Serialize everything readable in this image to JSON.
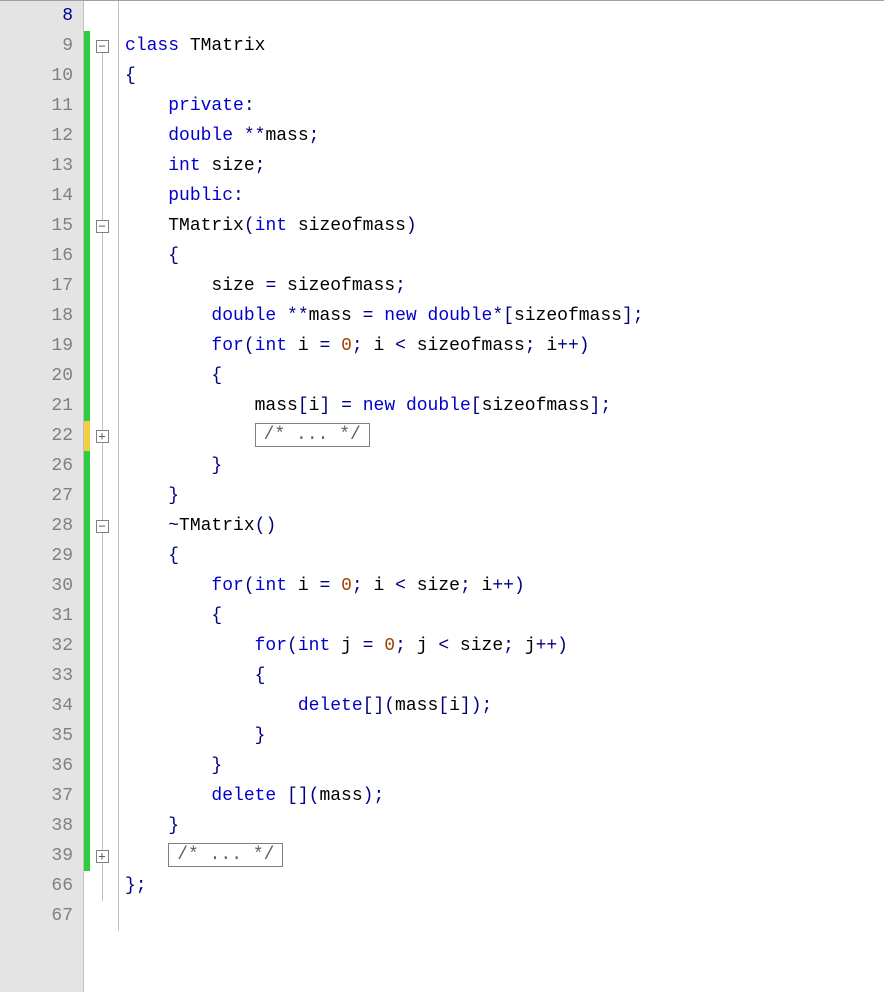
{
  "lineNumbers": [
    "8",
    "9",
    "10",
    "11",
    "12",
    "13",
    "14",
    "15",
    "16",
    "17",
    "18",
    "19",
    "20",
    "21",
    "22",
    "26",
    "27",
    "28",
    "29",
    "30",
    "31",
    "32",
    "33",
    "34",
    "35",
    "36",
    "37",
    "38",
    "39",
    "66",
    "67"
  ],
  "currentLine": "8",
  "changeBars": [
    "none",
    "green",
    "green",
    "green",
    "green",
    "green",
    "green",
    "green",
    "green",
    "green",
    "green",
    "green",
    "green",
    "green",
    "yellow",
    "green",
    "green",
    "green",
    "green",
    "green",
    "green",
    "green",
    "green",
    "green",
    "green",
    "green",
    "green",
    "green",
    "green",
    "none",
    "none"
  ],
  "foldCells": [
    {
      "type": "none"
    },
    {
      "type": "minus",
      "line": "start"
    },
    {
      "type": "line"
    },
    {
      "type": "line"
    },
    {
      "type": "line"
    },
    {
      "type": "line"
    },
    {
      "type": "line"
    },
    {
      "type": "minus",
      "line": "mid"
    },
    {
      "type": "line"
    },
    {
      "type": "line"
    },
    {
      "type": "line"
    },
    {
      "type": "line"
    },
    {
      "type": "line"
    },
    {
      "type": "line"
    },
    {
      "type": "plus",
      "line": "mid"
    },
    {
      "type": "line"
    },
    {
      "type": "line"
    },
    {
      "type": "minus",
      "line": "mid"
    },
    {
      "type": "line"
    },
    {
      "type": "line"
    },
    {
      "type": "line"
    },
    {
      "type": "line"
    },
    {
      "type": "line"
    },
    {
      "type": "line"
    },
    {
      "type": "line"
    },
    {
      "type": "line"
    },
    {
      "type": "line"
    },
    {
      "type": "line"
    },
    {
      "type": "plus",
      "line": "mid"
    },
    {
      "type": "line"
    },
    {
      "type": "none"
    }
  ],
  "foldedText": "/* ... */",
  "code": [
    {
      "indent": "",
      "tokens": []
    },
    {
      "indent": "",
      "tokens": [
        {
          "t": "kw",
          "v": "class"
        },
        {
          "t": "plain",
          "v": " TMatrix"
        }
      ]
    },
    {
      "indent": "",
      "tokens": [
        {
          "t": "op",
          "v": "{"
        }
      ]
    },
    {
      "indent": "    ",
      "tokens": [
        {
          "t": "kw",
          "v": "private"
        },
        {
          "t": "op",
          "v": ":"
        }
      ]
    },
    {
      "indent": "    ",
      "tokens": [
        {
          "t": "kw",
          "v": "double"
        },
        {
          "t": "plain",
          "v": " "
        },
        {
          "t": "op",
          "v": "**"
        },
        {
          "t": "plain",
          "v": "mass"
        },
        {
          "t": "op",
          "v": ";"
        }
      ]
    },
    {
      "indent": "    ",
      "tokens": [
        {
          "t": "kw",
          "v": "int"
        },
        {
          "t": "plain",
          "v": " size"
        },
        {
          "t": "op",
          "v": ";"
        }
      ]
    },
    {
      "indent": "    ",
      "tokens": [
        {
          "t": "kw",
          "v": "public"
        },
        {
          "t": "op",
          "v": ":"
        }
      ]
    },
    {
      "indent": "    ",
      "tokens": [
        {
          "t": "plain",
          "v": "TMatrix"
        },
        {
          "t": "op",
          "v": "("
        },
        {
          "t": "kw",
          "v": "int"
        },
        {
          "t": "plain",
          "v": " sizeofmass"
        },
        {
          "t": "op",
          "v": ")"
        }
      ]
    },
    {
      "indent": "    ",
      "tokens": [
        {
          "t": "op",
          "v": "{"
        }
      ]
    },
    {
      "indent": "        ",
      "tokens": [
        {
          "t": "plain",
          "v": "size "
        },
        {
          "t": "op",
          "v": "="
        },
        {
          "t": "plain",
          "v": " sizeofmass"
        },
        {
          "t": "op",
          "v": ";"
        }
      ]
    },
    {
      "indent": "        ",
      "tokens": [
        {
          "t": "kw",
          "v": "double"
        },
        {
          "t": "plain",
          "v": " "
        },
        {
          "t": "op",
          "v": "**"
        },
        {
          "t": "plain",
          "v": "mass "
        },
        {
          "t": "op",
          "v": "="
        },
        {
          "t": "plain",
          "v": " "
        },
        {
          "t": "kw",
          "v": "new"
        },
        {
          "t": "plain",
          "v": " "
        },
        {
          "t": "kw",
          "v": "double"
        },
        {
          "t": "op",
          "v": "*["
        },
        {
          "t": "plain",
          "v": "sizeofmass"
        },
        {
          "t": "op",
          "v": "];"
        }
      ]
    },
    {
      "indent": "        ",
      "tokens": [
        {
          "t": "kw",
          "v": "for"
        },
        {
          "t": "op",
          "v": "("
        },
        {
          "t": "kw",
          "v": "int"
        },
        {
          "t": "plain",
          "v": " i "
        },
        {
          "t": "op",
          "v": "="
        },
        {
          "t": "plain",
          "v": " "
        },
        {
          "t": "num",
          "v": "0"
        },
        {
          "t": "op",
          "v": ";"
        },
        {
          "t": "plain",
          "v": " i "
        },
        {
          "t": "op",
          "v": "<"
        },
        {
          "t": "plain",
          "v": " sizeofmass"
        },
        {
          "t": "op",
          "v": ";"
        },
        {
          "t": "plain",
          "v": " i"
        },
        {
          "t": "op",
          "v": "++)"
        }
      ]
    },
    {
      "indent": "        ",
      "tokens": [
        {
          "t": "op",
          "v": "{"
        }
      ]
    },
    {
      "indent": "            ",
      "tokens": [
        {
          "t": "plain",
          "v": "mass"
        },
        {
          "t": "op",
          "v": "["
        },
        {
          "t": "plain",
          "v": "i"
        },
        {
          "t": "op",
          "v": "]"
        },
        {
          "t": "plain",
          "v": " "
        },
        {
          "t": "op",
          "v": "="
        },
        {
          "t": "plain",
          "v": " "
        },
        {
          "t": "kw",
          "v": "new"
        },
        {
          "t": "plain",
          "v": " "
        },
        {
          "t": "kw",
          "v": "double"
        },
        {
          "t": "op",
          "v": "["
        },
        {
          "t": "plain",
          "v": "sizeofmass"
        },
        {
          "t": "op",
          "v": "];"
        }
      ]
    },
    {
      "indent": "            ",
      "tokens": [],
      "folded": true
    },
    {
      "indent": "        ",
      "tokens": [
        {
          "t": "op",
          "v": "}"
        }
      ]
    },
    {
      "indent": "    ",
      "tokens": [
        {
          "t": "op",
          "v": "}"
        }
      ]
    },
    {
      "indent": "    ",
      "tokens": [
        {
          "t": "op",
          "v": "~"
        },
        {
          "t": "plain",
          "v": "TMatrix"
        },
        {
          "t": "op",
          "v": "()"
        }
      ]
    },
    {
      "indent": "    ",
      "tokens": [
        {
          "t": "op",
          "v": "{"
        }
      ]
    },
    {
      "indent": "        ",
      "tokens": [
        {
          "t": "kw",
          "v": "for"
        },
        {
          "t": "op",
          "v": "("
        },
        {
          "t": "kw",
          "v": "int"
        },
        {
          "t": "plain",
          "v": " i "
        },
        {
          "t": "op",
          "v": "="
        },
        {
          "t": "plain",
          "v": " "
        },
        {
          "t": "num",
          "v": "0"
        },
        {
          "t": "op",
          "v": ";"
        },
        {
          "t": "plain",
          "v": " i "
        },
        {
          "t": "op",
          "v": "<"
        },
        {
          "t": "plain",
          "v": " size"
        },
        {
          "t": "op",
          "v": ";"
        },
        {
          "t": "plain",
          "v": " i"
        },
        {
          "t": "op",
          "v": "++)"
        }
      ]
    },
    {
      "indent": "        ",
      "tokens": [
        {
          "t": "op",
          "v": "{"
        }
      ]
    },
    {
      "indent": "            ",
      "tokens": [
        {
          "t": "kw",
          "v": "for"
        },
        {
          "t": "op",
          "v": "("
        },
        {
          "t": "kw",
          "v": "int"
        },
        {
          "t": "plain",
          "v": " j "
        },
        {
          "t": "op",
          "v": "="
        },
        {
          "t": "plain",
          "v": " "
        },
        {
          "t": "num",
          "v": "0"
        },
        {
          "t": "op",
          "v": ";"
        },
        {
          "t": "plain",
          "v": " j "
        },
        {
          "t": "op",
          "v": "<"
        },
        {
          "t": "plain",
          "v": " size"
        },
        {
          "t": "op",
          "v": ";"
        },
        {
          "t": "plain",
          "v": " j"
        },
        {
          "t": "op",
          "v": "++)"
        }
      ]
    },
    {
      "indent": "            ",
      "tokens": [
        {
          "t": "op",
          "v": "{"
        }
      ]
    },
    {
      "indent": "                ",
      "tokens": [
        {
          "t": "kw",
          "v": "delete"
        },
        {
          "t": "op",
          "v": "[]("
        },
        {
          "t": "plain",
          "v": "mass"
        },
        {
          "t": "op",
          "v": "["
        },
        {
          "t": "plain",
          "v": "i"
        },
        {
          "t": "op",
          "v": "]);"
        }
      ]
    },
    {
      "indent": "            ",
      "tokens": [
        {
          "t": "op",
          "v": "}"
        }
      ]
    },
    {
      "indent": "        ",
      "tokens": [
        {
          "t": "op",
          "v": "}"
        }
      ]
    },
    {
      "indent": "        ",
      "tokens": [
        {
          "t": "kw",
          "v": "delete"
        },
        {
          "t": "plain",
          "v": " "
        },
        {
          "t": "op",
          "v": "[]("
        },
        {
          "t": "plain",
          "v": "mass"
        },
        {
          "t": "op",
          "v": ");"
        }
      ]
    },
    {
      "indent": "    ",
      "tokens": [
        {
          "t": "op",
          "v": "}"
        }
      ]
    },
    {
      "indent": "    ",
      "tokens": [],
      "folded": true
    },
    {
      "indent": "",
      "tokens": [
        {
          "t": "op",
          "v": "};"
        }
      ]
    },
    {
      "indent": "",
      "tokens": []
    }
  ]
}
